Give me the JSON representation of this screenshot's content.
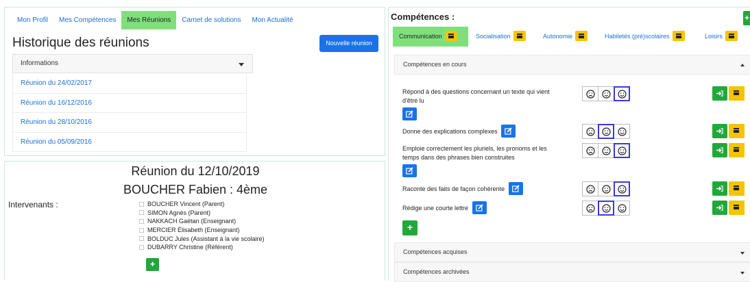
{
  "nav": {
    "items": [
      "Mon Profil",
      "Mes Compétences",
      "Mes Réunions",
      "Carnet de solutions",
      "Mon Actualité"
    ],
    "active_index": 2
  },
  "history": {
    "title": "Historique des réunions",
    "new_meeting_label": "Nouvelle réunion",
    "dropdown_label": "Informations",
    "meetings": [
      "Réunion du 24/02/2017",
      "Réunion du 16/12/2016",
      "Réunion du 28/10/2016",
      "Réunion du 05/09/2016"
    ]
  },
  "meeting": {
    "date_title": "Réunion du 12/10/2019",
    "student": "BOUCHER Fabien : 4ème",
    "intervenants_label": "Intervenants :",
    "participants": [
      "BOUCHER Vincent (Parent)",
      "SIMON Agnès (Parent)",
      "NAKKACH Gaëtan (Enseignant)",
      "MERCIER Élisabeth (Enseignant)",
      "BOLDUC Jules (Assistant à la vie scolaire)",
      "DUBARRY Christine (Référent)"
    ],
    "add_label": "+"
  },
  "competences": {
    "title": "Compétences :",
    "add_label": "+",
    "tabs": [
      "Communication",
      "Socialisation",
      "Autonomie",
      "Habiletés (pré)scolaires",
      "Loisirs"
    ],
    "active_tab": 0,
    "sections": {
      "current": "Compétences en cours",
      "acquired": "Compétences acquises",
      "archived": "Compétences archivées"
    },
    "skills": [
      {
        "text_line1": "Répond à des questions concernant un texte qui vient",
        "text_line2": "d'être lu",
        "selected_face": 2
      },
      {
        "text_line1": "Donne des explications complexes",
        "text_line2": "",
        "selected_face": 1
      },
      {
        "text_line1": "Emploie correctement les pluriels, les pronoms et les",
        "text_line2": "temps dans des phrases bien construites",
        "selected_face": 2
      },
      {
        "text_line1": "Raconte des faits de façon cohérente",
        "text_line2": "",
        "selected_face": 2
      },
      {
        "text_line1": "Rédige une courte lettre",
        "text_line2": "",
        "selected_face": 1
      }
    ],
    "add_skill_label": "+"
  },
  "colors": {
    "accent_blue": "#1a73e8",
    "active_green": "#7fe07b",
    "action_green": "#22a83a",
    "archive_yellow": "#f5c400",
    "selected_face_border": "#3b36e0"
  }
}
